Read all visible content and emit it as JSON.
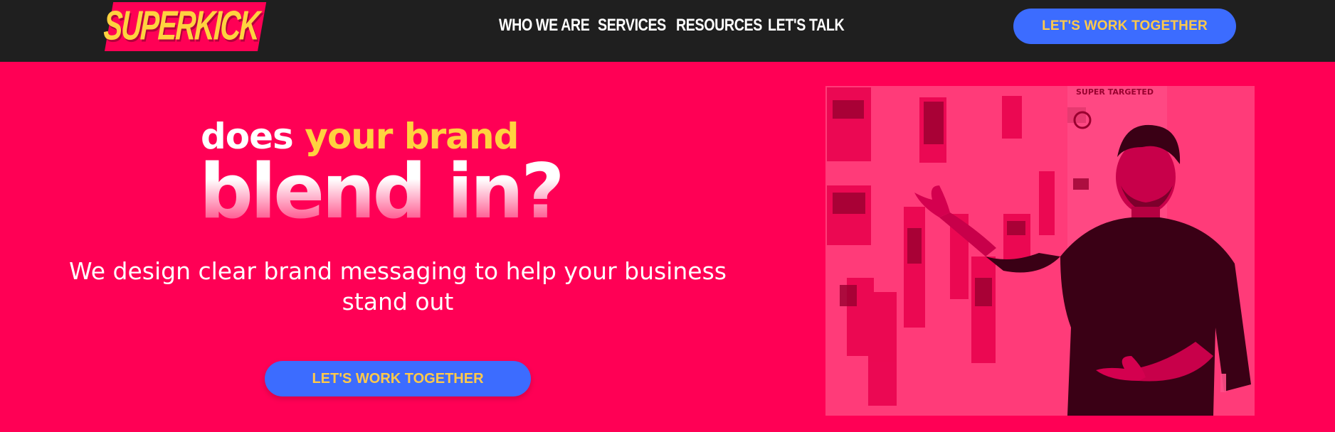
{
  "header": {
    "logo_text": "SUPERKICK",
    "nav": [
      "WHO WE ARE",
      "SERVICES",
      "RESOURCES",
      "LET'S TALK"
    ],
    "cta": "LET'S WORK TOGETHER"
  },
  "hero": {
    "headline_white": "does",
    "headline_yellow": "your brand",
    "headline_big": "blend in?",
    "subtitle": "We design clear brand messaging to help your business stand out",
    "cta": "LET'S WORK TOGETHER"
  },
  "colors": {
    "brand_pink": "#ff0055",
    "header_bg": "#1f1f1f",
    "accent_yellow": "#ffd23f",
    "button_blue": "#3c6cff",
    "button_text": "#ffc94a"
  }
}
